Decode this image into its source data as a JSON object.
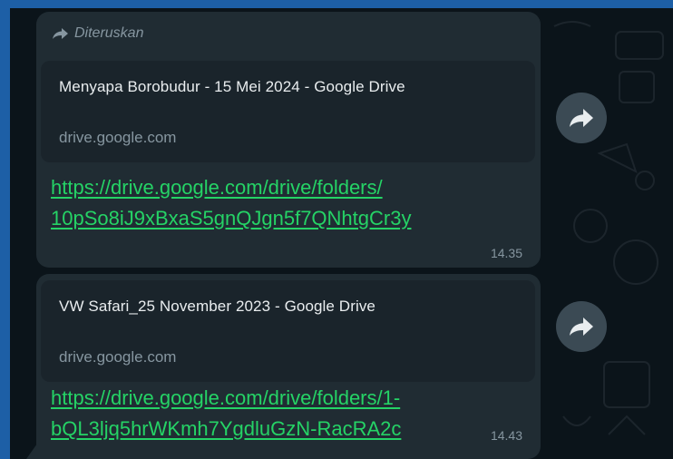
{
  "colors": {
    "frame": "#1d5fa6",
    "chat_bg": "#0b141a",
    "bubble": "#202c33",
    "link": "#25d366",
    "meta": "#8696a0",
    "share_button": "#3b4a54"
  },
  "messages": [
    {
      "forwarded_label": "Diteruskan",
      "forwarded_icon": "forward-arrow-icon",
      "preview_title": "Menyapa Borobudur - 15 Mei 2024 - Google Drive",
      "preview_domain": "drive.google.com",
      "link_line1": "https://drive.google.com/drive/folders/",
      "link_line2": "10pSo8iJ9xBxaS5gnQJgn5f7QNhtgCr3y",
      "time": "14.35",
      "share_icon": "share-forward-icon"
    },
    {
      "preview_title": "VW Safari_25 November 2023 - Google Drive",
      "preview_domain": "drive.google.com",
      "link_line1": "https://drive.google.com/drive/folders/1-",
      "link_line2": "bQL3ljq5hrWKmh7YgdluGzN-RacRA2c",
      "time": "14.43",
      "share_icon": "share-forward-icon"
    }
  ]
}
